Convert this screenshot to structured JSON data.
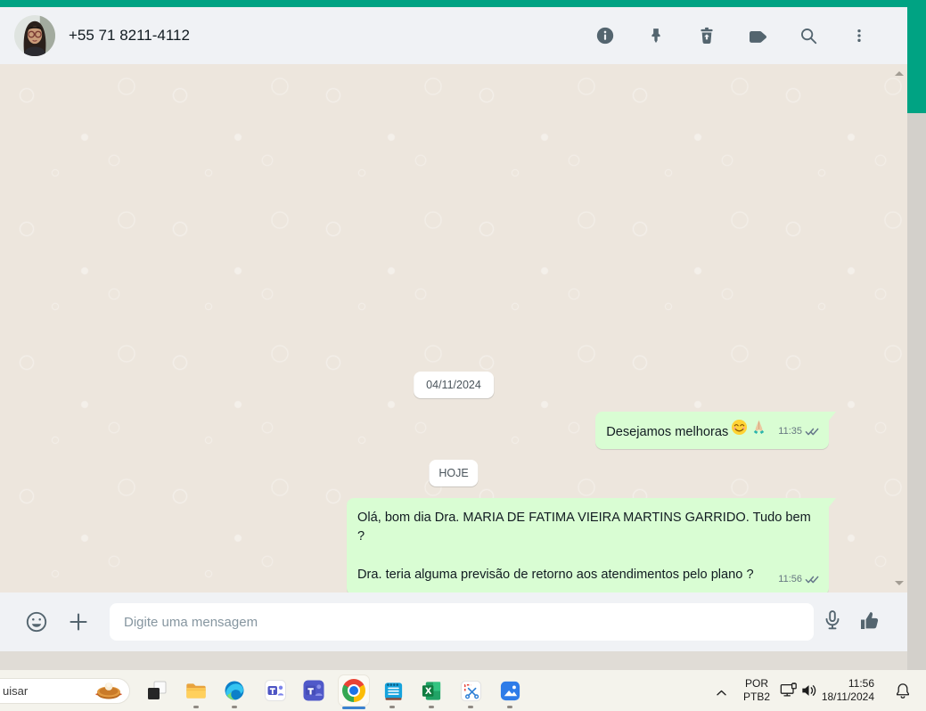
{
  "colors": {
    "accent_green": "#00a383",
    "header_bg": "#f0f2f5",
    "chat_bg": "#ede6dd",
    "bubble_outgoing": "#d9fdd3",
    "icon_slate": "#54656f",
    "taskbar_bg": "#f4f3ec",
    "chrome_active_bar": "#3b82d0"
  },
  "header": {
    "title": "+55 71 8211-4112",
    "icons": [
      "info-icon",
      "pin-icon",
      "trash-icon",
      "label-icon",
      "search-icon",
      "menu-icon"
    ]
  },
  "chat": {
    "date_chips": [
      "04/11/2024",
      "HOJE"
    ],
    "messages": [
      {
        "text": "Desejamos melhoras",
        "emoji": "😊🙏",
        "time": "11:35",
        "status_icon": "double-check"
      },
      {
        "line1": "Olá, bom dia Dra. MARIA DE FATIMA VIEIRA MARTINS GARRIDO. Tudo bem ?",
        "line2": "Dra. teria alguma previsão de retorno aos atendimentos pelo plano ?",
        "time": "11:56",
        "status_icon": "double-check"
      }
    ]
  },
  "composer": {
    "placeholder": "Digite uma mensagem",
    "icons": [
      "emoji-icon",
      "plus-icon",
      "mic-icon",
      "thumbs-up-icon"
    ]
  },
  "taskbar": {
    "search_text": "uisar",
    "search_graphic": "pumpkin-pie",
    "apps": [
      "task-view",
      "file-explorer",
      "edge",
      "teams",
      "teams-2",
      "chrome",
      "notepad",
      "excel",
      "snipping-tool",
      "photos"
    ],
    "active_app": "chrome",
    "tray": {
      "language": "POR",
      "layout": "PTB2",
      "time": "11:56",
      "date": "18/11/2024",
      "icons": [
        "chevron-up-icon",
        "network-icon",
        "speaker-icon",
        "bell-icon"
      ]
    }
  }
}
